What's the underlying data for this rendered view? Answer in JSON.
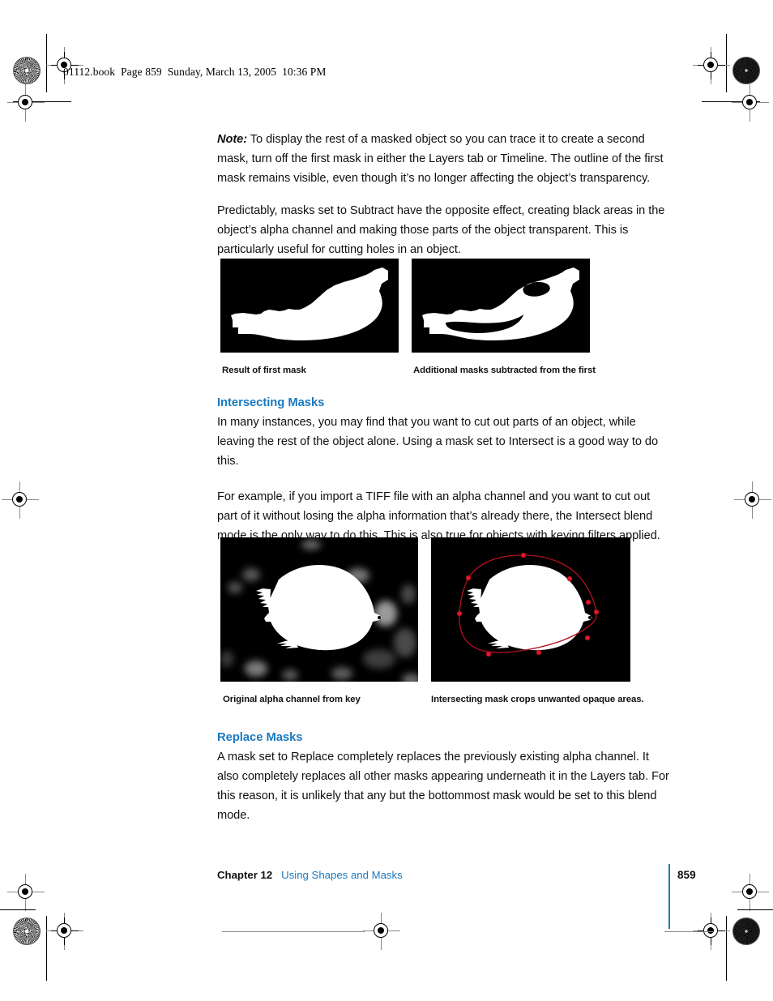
{
  "slug": "01112.book  Page 859  Sunday, March 13, 2005  10:36 PM",
  "content": {
    "note_paragraph": "Note:  To display the rest of a masked object so you can trace it to create a second mask, turn off the first mask in either the Layers tab or Timeline. The outline of the first mask remains visible, even though it’s no longer affecting the object’s transparency.",
    "note_label": "Note:",
    "note_text": "  To display the rest of a masked object so you can trace it to create a second mask, turn off the first mask in either the Layers tab or Timeline. The outline of the first mask remains visible, even though it’s no longer affecting the object’s transparency.",
    "subtract_paragraph": "Predictably, masks set to Subtract have the opposite effect, creating black areas in the object’s alpha channel and making those parts of the object transparent. This is particularly useful for cutting holes in an object.",
    "intersecting_heading": "Intersecting Masks",
    "intersecting_p1": "In many instances, you may find that you want to cut out parts of an object, while leaving the rest of the object alone. Using a mask set to Intersect is a good way to do this.",
    "intersecting_p2": "For example, if you import a TIFF file with an alpha channel and you want to cut out part of it without losing the alpha information that’s already there, the Intersect blend mode is the only way to do this. This is also true for objects with keying filters applied.",
    "replace_heading": "Replace Masks",
    "replace_p1": "A mask set to Replace completely replaces the previously existing alpha channel. It also completely replaces all other masks appearing underneath it in the Layers tab. For this reason, it is unlikely that any but the bottommost mask would be set to this blend mode."
  },
  "figures": {
    "row1": [
      {
        "caption": "Result of first mask"
      },
      {
        "caption": "Additional masks subtracted from the first"
      }
    ],
    "row2": [
      {
        "caption": "Original alpha channel from key"
      },
      {
        "caption": "Intersecting mask crops unwanted opaque areas."
      }
    ]
  },
  "footer": {
    "chapter": "Chapter 12",
    "chapter_title": "Using Shapes and Masks",
    "page_number": "859"
  },
  "colors": {
    "heading_blue": "#1a7ac0",
    "link_blue": "#2b8fd6",
    "rule_blue": "#1a7ac0",
    "mask_outline_red": "#b01020",
    "figure_background": "#000000"
  }
}
